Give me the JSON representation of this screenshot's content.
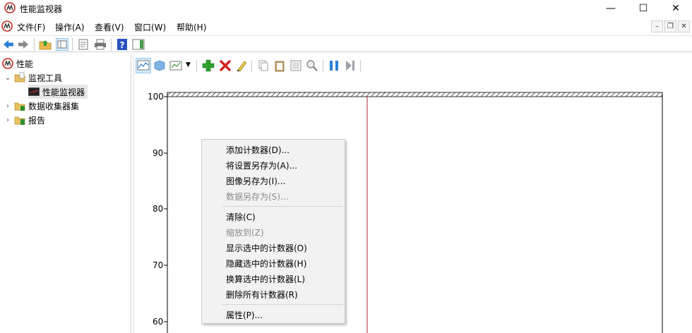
{
  "window": {
    "title": "性能监视器",
    "minimize_glyph": "—",
    "maximize_glyph": "☐",
    "close_glyph": "✕"
  },
  "menu": {
    "items": [
      "文件(F)",
      "操作(A)",
      "查看(V)",
      "窗口(W)",
      "帮助(H)"
    ],
    "mdi_minimize": "–",
    "mdi_restore": "❐",
    "mdi_close": "✕"
  },
  "toolbar": {
    "icons": [
      "back-icon",
      "forward-icon",
      "up-folder-icon",
      "show-hide-tree-icon",
      "properties-icon",
      "print-icon",
      "help-icon",
      "show-action-pane-icon"
    ]
  },
  "tree": {
    "items": [
      {
        "label": "性能",
        "icon": "performance-icon"
      },
      {
        "label": "监视工具",
        "icon": "folder-tools-icon"
      },
      {
        "label": "性能监视器",
        "icon": "perfmon-chart-icon"
      },
      {
        "label": "数据收集器集",
        "icon": "data-collector-icon"
      },
      {
        "label": "报告",
        "icon": "report-icon"
      }
    ]
  },
  "chart": {
    "y_ticks": [
      "100",
      "90",
      "80",
      "70",
      "60"
    ],
    "colors": {
      "timeline": "#b2273a",
      "frame": "#000000"
    }
  },
  "context_menu": {
    "groups": [
      [
        {
          "label": "添加计数器(D)...",
          "enabled": true
        },
        {
          "label": "将设置另存为(A)...",
          "enabled": true
        },
        {
          "label": "图像另存为(I)...",
          "enabled": true
        },
        {
          "label": "数据另存为(S)...",
          "enabled": false
        }
      ],
      [
        {
          "label": "清除(C)",
          "enabled": true
        },
        {
          "label": "缩放到(Z)",
          "enabled": false
        },
        {
          "label": "显示选中的计数器(O)",
          "enabled": true
        },
        {
          "label": "隐藏选中的计数器(H)",
          "enabled": true
        },
        {
          "label": "换算选中的计数器(L)",
          "enabled": true
        },
        {
          "label": "删除所有计数器(R)",
          "enabled": true
        }
      ],
      [
        {
          "label": "属性(P)...",
          "enabled": true
        }
      ]
    ]
  }
}
